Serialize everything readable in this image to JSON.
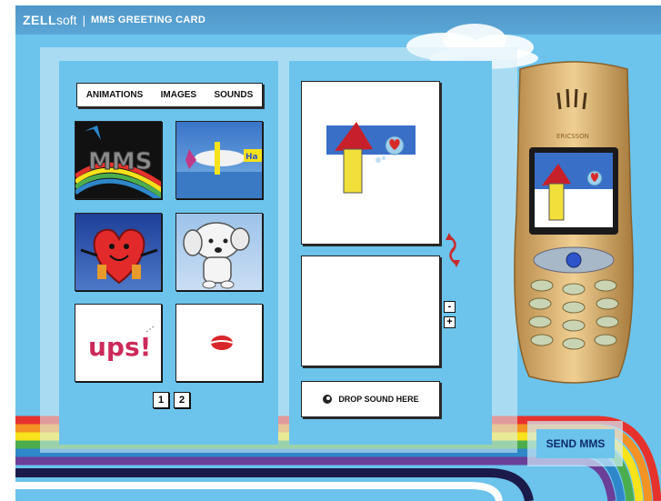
{
  "header": {
    "brand_strong": "ZELL",
    "brand_light": "soft",
    "separator": "|",
    "app_title": "MMS GREETING CARD"
  },
  "tabs": [
    "ANIMATIONS",
    "IMAGES",
    "SOUNDS"
  ],
  "gallery": {
    "items": [
      {
        "name": "mms-animation"
      },
      {
        "name": "airplane-animation"
      },
      {
        "name": "heart-animation"
      },
      {
        "name": "dog-animation"
      },
      {
        "name": "ups-animation",
        "text": "ups!"
      },
      {
        "name": "lips-animation"
      }
    ],
    "pages": [
      "1",
      "2"
    ]
  },
  "editor": {
    "drop_sound_label": "DROP SOUND HERE",
    "zoom_out": "-",
    "zoom_in": "+"
  },
  "phone": {
    "brand": "ERICSSON"
  },
  "actions": {
    "send_label": "SEND MMS"
  },
  "colors": {
    "background": "#6cc3ec",
    "title_bar": "#5aa6d6",
    "accent_dark": "#0c2b6a"
  }
}
